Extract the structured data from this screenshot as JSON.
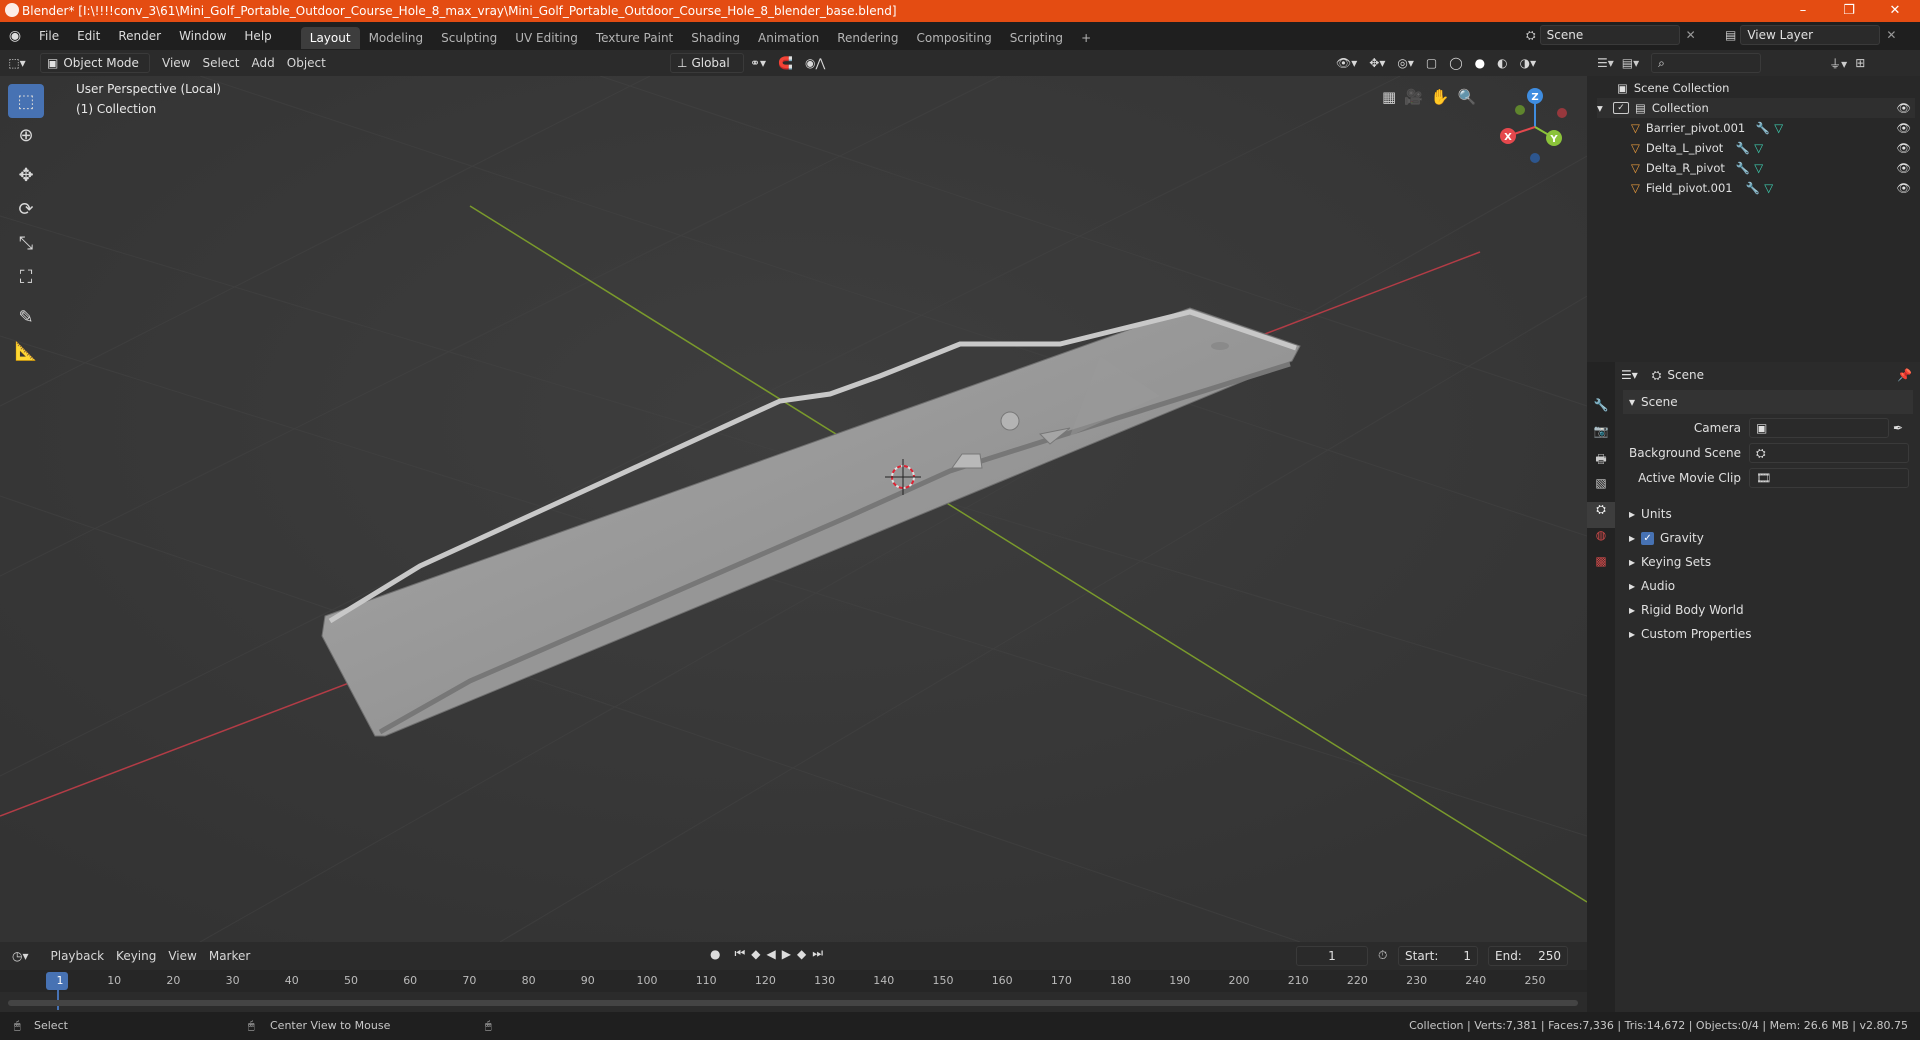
{
  "window": {
    "title": "Blender* [I:\\!!!!conv_3\\61\\Mini_Golf_Portable_Outdoor_Course_Hole_8_max_vray\\Mini_Golf_Portable_Outdoor_Course_Hole_8_blender_base.blend]",
    "minimize": "–",
    "restore": "❐",
    "close": "✕"
  },
  "menu": [
    "File",
    "Edit",
    "Render",
    "Window",
    "Help"
  ],
  "workspaces": [
    "Layout",
    "Modeling",
    "Sculpting",
    "UV Editing",
    "Texture Paint",
    "Shading",
    "Animation",
    "Rendering",
    "Compositing",
    "Scripting"
  ],
  "workspace_add": "+",
  "scene_field": "Scene",
  "viewlayer_field": "View Layer",
  "viewport_header": {
    "mode": "Object Mode",
    "menus": [
      "View",
      "Select",
      "Add",
      "Object"
    ],
    "transform_orientation": "Global"
  },
  "viewport": {
    "perspective": "User Perspective (Local)",
    "collection": "(1) Collection",
    "gizmo": {
      "x": "X",
      "y": "Y",
      "z": "Z"
    }
  },
  "outliner": {
    "root": "Scene Collection",
    "collection": "Collection",
    "items": [
      "Barrier_pivot.001",
      "Delta_L_pivot",
      "Delta_R_pivot",
      "Field_pivot.001"
    ]
  },
  "properties": {
    "context": "Scene",
    "section": "Scene",
    "fields": [
      {
        "label": "Camera"
      },
      {
        "label": "Background Scene"
      },
      {
        "label": "Active Movie Clip"
      }
    ],
    "panels": [
      "Units",
      "Gravity",
      "Keying Sets",
      "Audio",
      "Rigid Body World",
      "Custom Properties"
    ],
    "gravity_checked": true
  },
  "timeline": {
    "menus": [
      "Playback",
      "Keying",
      "View",
      "Marker"
    ],
    "current_frame": "1",
    "start_label": "Start:",
    "start": "1",
    "end_label": "End:",
    "end": "250",
    "ticks": [
      "1",
      "10",
      "20",
      "30",
      "40",
      "50",
      "60",
      "70",
      "80",
      "90",
      "100",
      "110",
      "120",
      "130",
      "140",
      "150",
      "160",
      "170",
      "180",
      "190",
      "200",
      "210",
      "220",
      "230",
      "240",
      "250"
    ]
  },
  "status": {
    "left_action": "Select",
    "mid_action": "Center View to Mouse",
    "stats": "Collection | Verts:7,381 | Faces:7,336 | Tris:14,672 | Objects:0/4 | Mem: 26.6 MB | v2.80.75"
  },
  "colors": {
    "titlebar": "#e44c12",
    "accent": "#4772b3",
    "x_axis": "#e5484d",
    "y_axis": "#8bc33a",
    "z_axis": "#3f8de0"
  }
}
